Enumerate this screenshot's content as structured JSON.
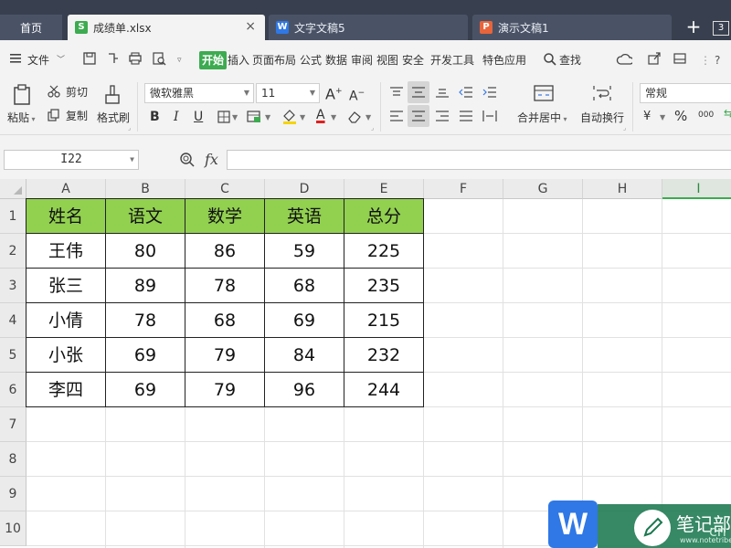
{
  "tabs": {
    "home": "首页",
    "docs": [
      {
        "icon_letter": "S",
        "icon_color": "#3dab50",
        "name": "成绩单.xlsx",
        "active": true
      },
      {
        "icon_letter": "W",
        "icon_color": "#2f78e6",
        "name": "文字文稿5",
        "active": false
      },
      {
        "icon_letter": "P",
        "icon_color": "#e8643a",
        "name": "演示文稿1",
        "active": false
      }
    ],
    "new_tab": "+",
    "window_count": "3"
  },
  "menu": {
    "file": "文件",
    "items": [
      "开始",
      "插入",
      "页面布局",
      "公式",
      "数据",
      "审阅",
      "视图",
      "安全",
      "开发工具",
      "特色应用"
    ],
    "active_item": "开始",
    "search": "查找",
    "help": "?"
  },
  "ribbon": {
    "paste": "粘贴",
    "cut": "剪切",
    "copy": "复制",
    "format_painter": "格式刷",
    "font_name": "微软雅黑",
    "font_size": "11",
    "merge_center": "合并居中",
    "wrap_text": "自动换行",
    "number_format": "常规",
    "percent": "%",
    "thousands": "000"
  },
  "formula_bar": {
    "name_box": "I22",
    "fx": "fx",
    "formula": ""
  },
  "sheet": {
    "columns": [
      "A",
      "B",
      "C",
      "D",
      "E",
      "F",
      "G",
      "H",
      "I"
    ],
    "selected_column": "I",
    "rows": [
      "1",
      "2",
      "3",
      "4",
      "5",
      "6",
      "7",
      "8",
      "9",
      "10"
    ],
    "header_fill": "#92d050",
    "table": {
      "headers": [
        "姓名",
        "语文",
        "数学",
        "英语",
        "总分"
      ],
      "records": [
        [
          "王伟",
          "80",
          "86",
          "59",
          "225"
        ],
        [
          "张三",
          "89",
          "78",
          "68",
          "235"
        ],
        [
          "小倩",
          "78",
          "68",
          "69",
          "215"
        ],
        [
          "小张",
          "69",
          "79",
          "84",
          "232"
        ],
        [
          "李四",
          "69",
          "79",
          "96",
          "244"
        ]
      ]
    }
  },
  "watermark": {
    "logo_letter": "W",
    "brand": "笔记部落",
    "site": "www.notetribe.com",
    "suffix": "cn"
  }
}
